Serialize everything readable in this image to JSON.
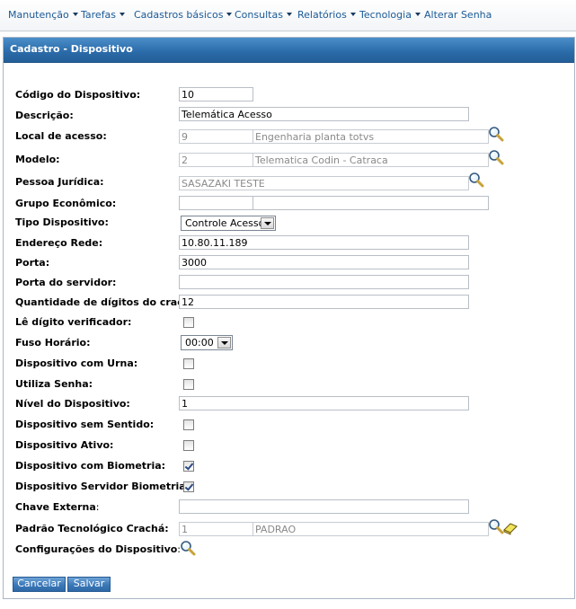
{
  "menu": [
    {
      "label": "Manutenção",
      "has_arrow": true
    },
    {
      "label": "Tarefas",
      "has_arrow": true
    },
    {
      "label": "Cadastros básicos",
      "has_arrow": true
    },
    {
      "label": "Consultas",
      "has_arrow": true
    },
    {
      "label": "Relatórios",
      "has_arrow": true
    },
    {
      "label": "Tecnologia",
      "has_arrow": true
    },
    {
      "label": "Alterar Senha",
      "has_arrow": false
    }
  ],
  "panel": {
    "title": "Cadastro - Dispositivo"
  },
  "form": {
    "codigo": {
      "label": "Código do Dispositivo:",
      "value": "10"
    },
    "descricao": {
      "label": "Descrição:",
      "value": "Telemática Acesso"
    },
    "local": {
      "label": "Local de acesso:",
      "code": "9",
      "name": "Engenharia planta totvs"
    },
    "modelo": {
      "label": "Modelo:",
      "code": "2",
      "name": "Telematica Codin - Catraca"
    },
    "pessoa": {
      "label": "Pessoa Jurídica:",
      "value": "SASAZAKI TESTE"
    },
    "grupo": {
      "label": "Grupo Econômico:",
      "code": "",
      "name": ""
    },
    "tipo": {
      "label": "Tipo Dispositivo:",
      "value": "Controle Acesso"
    },
    "endereco": {
      "label": "Endereço Rede:",
      "value": "10.80.11.189"
    },
    "porta": {
      "label": "Porta:",
      "value": "3000"
    },
    "porta_servidor": {
      "label": "Porta do servidor:",
      "value": ""
    },
    "qtd_digitos": {
      "label": "Quantidade de dígitos do crachá:",
      "value": "12"
    },
    "le_digito": {
      "label": "Lê dígito verificador:",
      "checked": false
    },
    "fuso": {
      "label": "Fuso Horário:",
      "value": "00:00"
    },
    "urna": {
      "label": "Dispositivo com Urna:",
      "checked": false
    },
    "utiliza_senha": {
      "label": "Utiliza Senha:",
      "checked": false
    },
    "nivel": {
      "label": "Nível do Dispositivo:",
      "value": "1"
    },
    "sem_sentido": {
      "label": "Dispositivo sem Sentido:",
      "checked": false
    },
    "ativo": {
      "label": "Dispositivo Ativo:",
      "checked": false
    },
    "biometria": {
      "label": "Dispositivo com Biometria:",
      "checked": true
    },
    "servidor_biometria": {
      "label": "Dispositivo Servidor Biometria:",
      "checked": true
    },
    "chave_externa": {
      "label": "Chave Externa",
      "value": ""
    },
    "padrao": {
      "label": "Padrão Tecnológico Crachá:",
      "code": "1",
      "name": "PADRAO"
    },
    "config": {
      "label": "Configurações do Dispositivo"
    }
  },
  "buttons": {
    "cancel": "Cancelar",
    "save": "Salvar"
  },
  "colors": {
    "header_blue": "#2a6aa8",
    "menu_link": "#1a5a96",
    "button_blue": "#3a78b8"
  },
  "icons": {
    "search": "magnifier-icon",
    "clear": "eraser-icon"
  }
}
